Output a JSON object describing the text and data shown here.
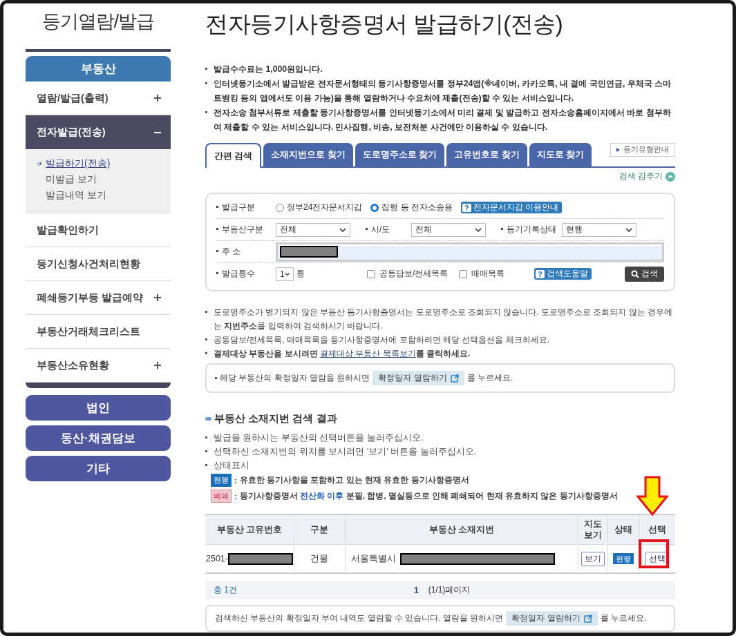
{
  "sidebar": {
    "title": "등기열람/발급",
    "categories": [
      {
        "label": "부동산",
        "selected": true
      }
    ],
    "items": [
      {
        "label": "열람/발급(출력)",
        "kind": "expandable",
        "expanded": false
      },
      {
        "label": "전자발급(전송)",
        "kind": "expandable",
        "expanded": true,
        "children": [
          {
            "label": "발급하기(전송)",
            "selected": true
          },
          {
            "label": "미발급 보기",
            "selected": false
          },
          {
            "label": "발급내역 보기",
            "selected": false
          }
        ]
      },
      {
        "label": "발급확인하기",
        "kind": "link"
      },
      {
        "label": "등기신청사건처리현황",
        "kind": "link"
      },
      {
        "label": "폐쇄등기부등 발급예약",
        "kind": "expandable",
        "expanded": false
      },
      {
        "label": "부동산거래체크리스트",
        "kind": "link"
      },
      {
        "label": "부동산소유현황",
        "kind": "expandable",
        "expanded": false
      }
    ],
    "other_categories": [
      {
        "label": "법인",
        "selected": false
      },
      {
        "label": "동산·채권담보",
        "selected": false
      },
      {
        "label": "기타",
        "selected": false
      }
    ]
  },
  "page_title": "전자등기사항증명서 발급하기(전송)",
  "notices": [
    "발급수수료는 1,000원입니다.",
    "인터넷등기소에서 발급받은 전자문서형태의 등기사항증명서를 정부24앱(※네이버, 카카오톡, 내 곁에 국민연금, 우체국 스마트뱅킹 등의 앱에서도 이용 가능)을 통해 열람하거나 수요처에 제출(전송)할 수 있는 서비스입니다.",
    "전자소송 첨부서류로 제출할 등기사항증명서를 인터넷등기소에서 미리 결제 및 발급하고 전자소송홈페이지에서 바로 첨부하여 제출할 수 있는 서비스입니다. 민사집행, 비송, 보전처분 사건에만 이용하실 수 있습니다."
  ],
  "tabs": [
    {
      "label": "간편 검색",
      "selected": true
    },
    {
      "label": "소재지번으로 찾기",
      "selected": false
    },
    {
      "label": "도로명주소로 찾기",
      "selected": false
    },
    {
      "label": "고유번호로 찾기",
      "selected": false
    },
    {
      "label": "지도로 찾기",
      "selected": false
    }
  ],
  "guide_button": "등기유형안내",
  "hide_search": "검색 감추기",
  "form": {
    "issue_type": {
      "label": "발급구분",
      "options": [
        {
          "label": "정부24전자문서지갑",
          "selected": false
        },
        {
          "label": "집행 등 전자소송용",
          "selected": true
        }
      ],
      "help_icon": "?",
      "help": "전자문서지갑 이용안내"
    },
    "selects": [
      {
        "label": "부동산구분",
        "value": "전체"
      },
      {
        "label": "시/도",
        "value": "전체"
      },
      {
        "label": "등기기록상태",
        "value": "현행"
      }
    ],
    "address": {
      "label": "주 소",
      "redacted": true
    },
    "count": {
      "label": "발급통수",
      "value": "1",
      "unit": "통"
    },
    "checkboxes": [
      {
        "label": "공동담보/전세목록",
        "checked": false
      },
      {
        "label": "매매목록",
        "checked": false
      }
    ],
    "help_icon": "?",
    "help": "검색도움말",
    "search_button": "검색"
  },
  "notes": [
    "도로명주소가 병기되지 않은 부동산 등기사항증명서는 도로명주소로 조회되지 않습니다. 도로명주소로 조회되지 않는 경우에는 **지번주소**를 입력하여 검색하시기 바랍니다.",
    "공동담보/전세목록, 매매목록을 등기사항증명서에 포함하려면 해당 선택옵션을 체크하세요."
  ],
  "payment_note": {
    "before": "결제대상 부동산을 보시려면",
    "link": "결제대상 부동산 목록보기",
    "after": "를 클릭하세요."
  },
  "date_box": {
    "before": "해당 부동산의 확정일자 열람을 원하시면",
    "button": "확정일자 열람하기",
    "after": "를 누르세요."
  },
  "results": {
    "title": "부동산 소재지번 검색 결과",
    "bullets": [
      "발급을 원하시는 부동산의 선택버튼을 눌러주십시오.",
      "선택하신 소재지번의 위치를 보시려면 '보기' 버튼을 눌러주십시오.",
      "상태표시"
    ],
    "legend": [
      {
        "badge": "현행",
        "color": "#1f6fb5",
        "colon": ":",
        "before": "유효한 등기사항을 포함하고 있는 현재 유효한 등기사항증명서"
      },
      {
        "badge": "폐쇄",
        "color": "#f7c9d0",
        "colon": ":",
        "before": "등기사항증명서",
        "highlight": "전산화 이후",
        "after": "분필, 합병, 멸실등으로 인해 폐쇄되어 현재 유효하지 않은 등기사항증명서"
      }
    ],
    "columns": [
      "부동산 고유번호",
      "구분",
      "부동산 소재지번",
      "지도 보기",
      "상태",
      "선택"
    ],
    "rows": [
      {
        "id_prefix": "2501-",
        "id_redacted": true,
        "type": "건물",
        "address_prefix": "서울특별시",
        "address_redacted": true,
        "map_button": "보기",
        "status": "현행",
        "select_button": "선택",
        "highlighted": true
      }
    ],
    "total": "총 1건",
    "page": "1",
    "page_info": "(1/1)페이지",
    "footer": {
      "before": "검색하신 부동산의 확정일자 부여 내역도 열람할 수 있습니다. 열람을 원하시면",
      "button": "확정일자 열람하기",
      "after": "를 누르세요."
    }
  }
}
